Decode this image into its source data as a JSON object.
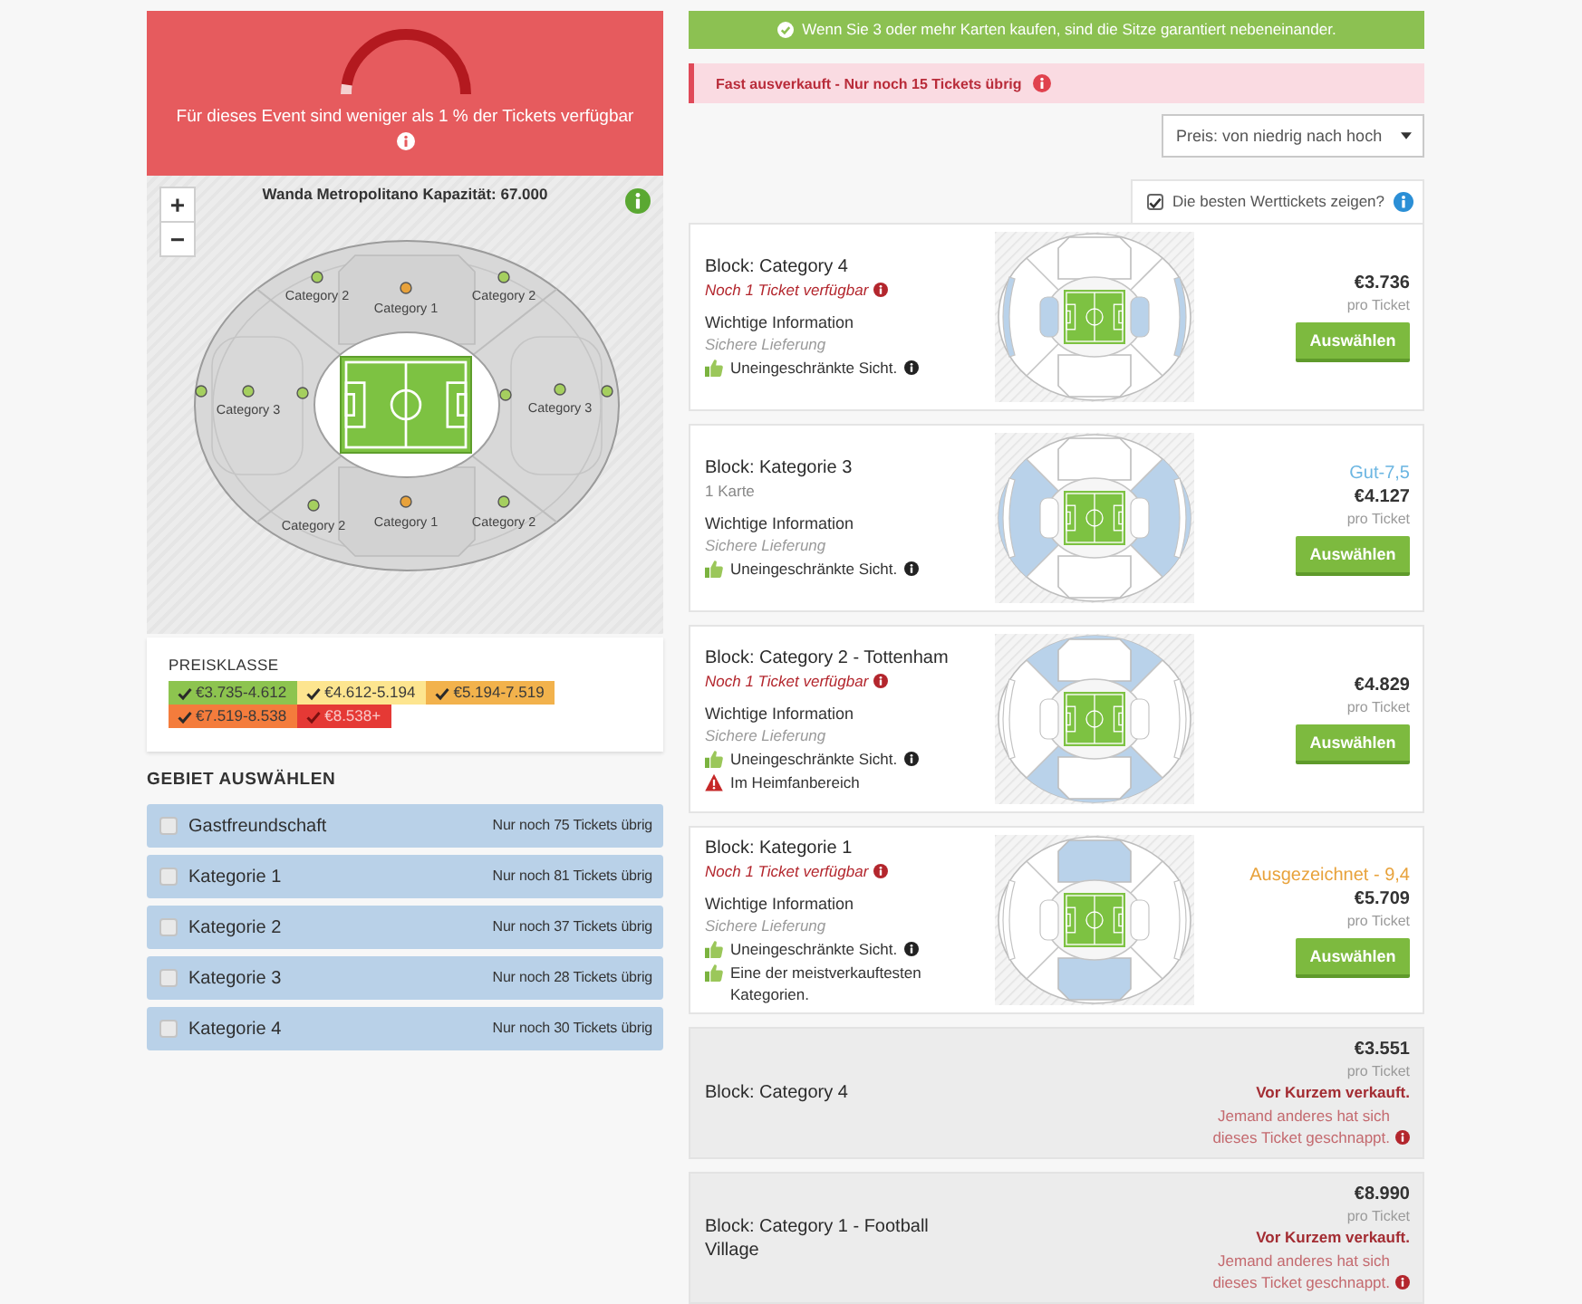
{
  "availability": {
    "message": "Für dieses Event sind weniger als 1 % der Tickets verfügbar",
    "level": 0.05
  },
  "stadium_map": {
    "title": "Wanda Metropolitano Kapazität: 67.000",
    "zoom_in": "+",
    "zoom_out": "−",
    "sections": [
      {
        "label": "Category 2",
        "color": "#a5cf5f"
      },
      {
        "label": "Category 1",
        "color": "#e8a23b"
      },
      {
        "label": "Category 2",
        "color": "#a5cf5f"
      },
      {
        "label": "Category 3",
        "color": "#a5cf5f"
      },
      {
        "label": "Category 3",
        "color": "#a5cf5f"
      },
      {
        "label": "Category 2",
        "color": "#a5cf5f"
      },
      {
        "label": "Category 1",
        "color": "#e8a23b"
      },
      {
        "label": "Category 2",
        "color": "#a5cf5f"
      }
    ],
    "markers": [
      {
        "color": "#a5cf5f"
      },
      {
        "color": "#a5cf5f"
      },
      {
        "color": "#a5cf5f"
      },
      {
        "color": "#a5cf5f"
      }
    ]
  },
  "price_legend": {
    "title": "PREISKLASSE",
    "ranges": [
      {
        "label": "€3.735-4.612",
        "color": "#8dc44f",
        "checked": true
      },
      {
        "label": "€4.612-5.194",
        "color": "#fde58f",
        "checked": true
      },
      {
        "label": "€5.194-7.519",
        "color": "#f2b24c",
        "checked": true
      },
      {
        "label": "€7.519-8.538",
        "color": "#f47c3c",
        "checked": true
      },
      {
        "label": "€8.538+",
        "color": "#e53935",
        "checked": true
      }
    ]
  },
  "areas_heading": "GEBIET AUSWÄHLEN",
  "areas": [
    {
      "name": "Gastfreundschaft",
      "remaining": "Nur noch 75 Tickets übrig",
      "checked": false
    },
    {
      "name": "Kategorie 1",
      "remaining": "Nur noch 81 Tickets übrig",
      "checked": false
    },
    {
      "name": "Kategorie 2",
      "remaining": "Nur noch 37 Tickets übrig",
      "checked": false
    },
    {
      "name": "Kategorie 3",
      "remaining": "Nur noch 28 Tickets übrig",
      "checked": false
    },
    {
      "name": "Kategorie 4",
      "remaining": "Nur noch 30 Tickets übrig",
      "checked": false
    }
  ],
  "seat_notice": "Wenn Sie 3 oder mehr Karten kaufen, sind die Sitze garantiert nebeneinander.",
  "alert": "Fast ausverkauft - Nur noch 15 Tickets übrig",
  "sort": {
    "value": "Preis: von niedrig nach hoch"
  },
  "best_value": {
    "label": "Die besten Werttickets zeigen?",
    "checked": true
  },
  "tickets": [
    {
      "kind": "available",
      "block": "Block: Category 4",
      "subtitle": {
        "kind": "urgent",
        "text": "Noch 1 Ticket verfügbar"
      },
      "info_heading": "Wichtige Information",
      "delivery": "Sichere Lieferung",
      "features": [
        {
          "kind": "positive",
          "text": "Uneingeschränkte Sicht.",
          "info": true
        }
      ],
      "seat_map": {
        "kind": "ends"
      },
      "price": "€3.736",
      "price_unit": "pro Ticket",
      "button": "Auswählen"
    },
    {
      "kind": "available",
      "block": "Block: Kategorie 3",
      "subtitle": {
        "kind": "plain",
        "text": "1 Karte"
      },
      "info_heading": "Wichtige Information",
      "delivery": "Sichere Lieferung",
      "features": [
        {
          "kind": "positive",
          "text": "Uneingeschränkte Sicht.",
          "info": true
        }
      ],
      "seat_map": {
        "kind": "wings"
      },
      "rating": {
        "text": "Gut-7,5",
        "color": "#6cb6e2"
      },
      "price": "€4.127",
      "price_unit": "pro Ticket",
      "button": "Auswählen"
    },
    {
      "kind": "available",
      "block": "Block: Category 2 - Tottenham",
      "subtitle": {
        "kind": "urgent",
        "text": "Noch 1 Ticket verfügbar"
      },
      "info_heading": "Wichtige Information",
      "delivery": "Sichere Lieferung",
      "features": [
        {
          "kind": "positive",
          "text": "Uneingeschränkte Sicht.",
          "info": true
        },
        {
          "kind": "warning",
          "text": "Im Heimfanbereich",
          "info": false
        }
      ],
      "seat_map": {
        "kind": "corners"
      },
      "price": "€4.829",
      "price_unit": "pro Ticket",
      "button": "Auswählen"
    },
    {
      "kind": "available",
      "block": "Block: Kategorie 1",
      "subtitle": {
        "kind": "urgent",
        "text": "Noch 1 Ticket verfügbar"
      },
      "info_heading": "Wichtige Information",
      "delivery": "Sichere Lieferung",
      "features": [
        {
          "kind": "positive",
          "text": "Uneingeschränkte Sicht.",
          "info": true
        },
        {
          "kind": "positive",
          "text": "Eine der meistverkauftesten Kategorien.",
          "info": false
        }
      ],
      "seat_map": {
        "kind": "center"
      },
      "rating": {
        "text": "Ausgezeichnet - 9,4",
        "color": "#e8a23b"
      },
      "price": "€5.709",
      "price_unit": "pro Ticket",
      "button": "Auswählen"
    },
    {
      "kind": "sold",
      "block": "Block: Category 4",
      "price": "€3.551",
      "price_unit": "pro Ticket",
      "sold_title": "Vor Kurzem verkauft.",
      "sold_text": "Jemand anderes hat sich dieses Ticket geschnappt."
    },
    {
      "kind": "sold",
      "block": "Block: Category 1 - Football Village",
      "price": "€8.990",
      "price_unit": "pro Ticket",
      "sold_title": "Vor Kurzem verkauft.",
      "sold_text": "Jemand anderes hat sich dieses Ticket geschnappt."
    }
  ]
}
